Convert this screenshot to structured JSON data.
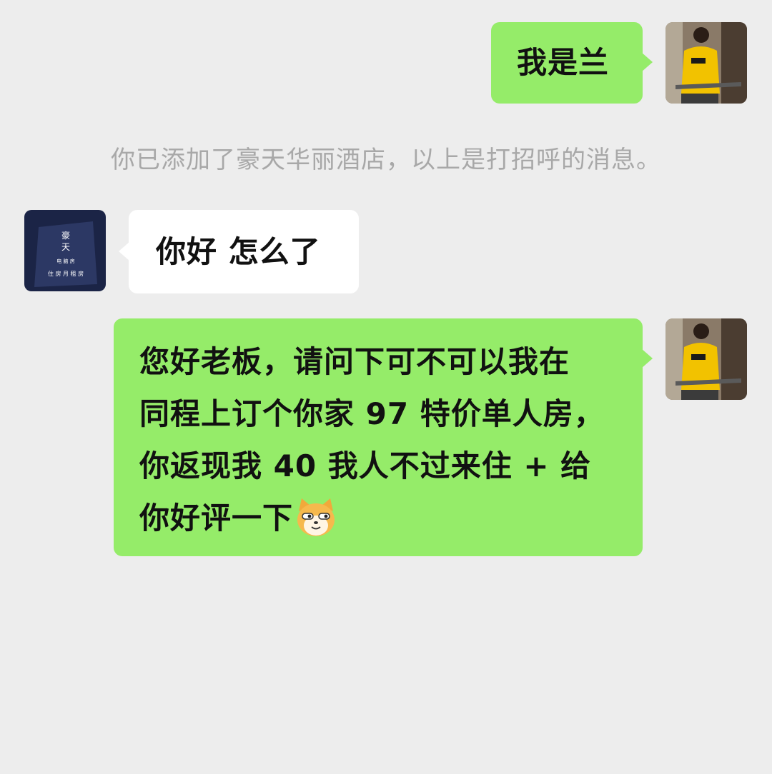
{
  "colors": {
    "background": "#ededed",
    "sent_bubble": "#95ec69",
    "received_bubble": "#ffffff",
    "system_text": "#a8a8a8",
    "message_text": "#111111"
  },
  "messages": [
    {
      "direction": "sent",
      "avatar": "sender-avatar-photo",
      "text": "我是兰"
    },
    {
      "direction": "received",
      "avatar": "hotel-avatar-sign",
      "text": "你好 怎么了"
    },
    {
      "direction": "sent",
      "avatar": "sender-avatar-photo",
      "lines": [
        "您好老板，请问下可不可以我在",
        "同程上订个你家 97 特价单人房，",
        "你返现我 40 我人不过来住 + 给",
        "你好评一下"
      ],
      "emoji": "doge-cat-emoji"
    }
  ],
  "system_notice": "你已添加了豪天华丽酒店，以上是打招呼的消息。",
  "hotel_avatar": {
    "line1": "豪",
    "line2": "天",
    "line3": "电 脑 房",
    "line4": "住 房   月 租 房"
  }
}
